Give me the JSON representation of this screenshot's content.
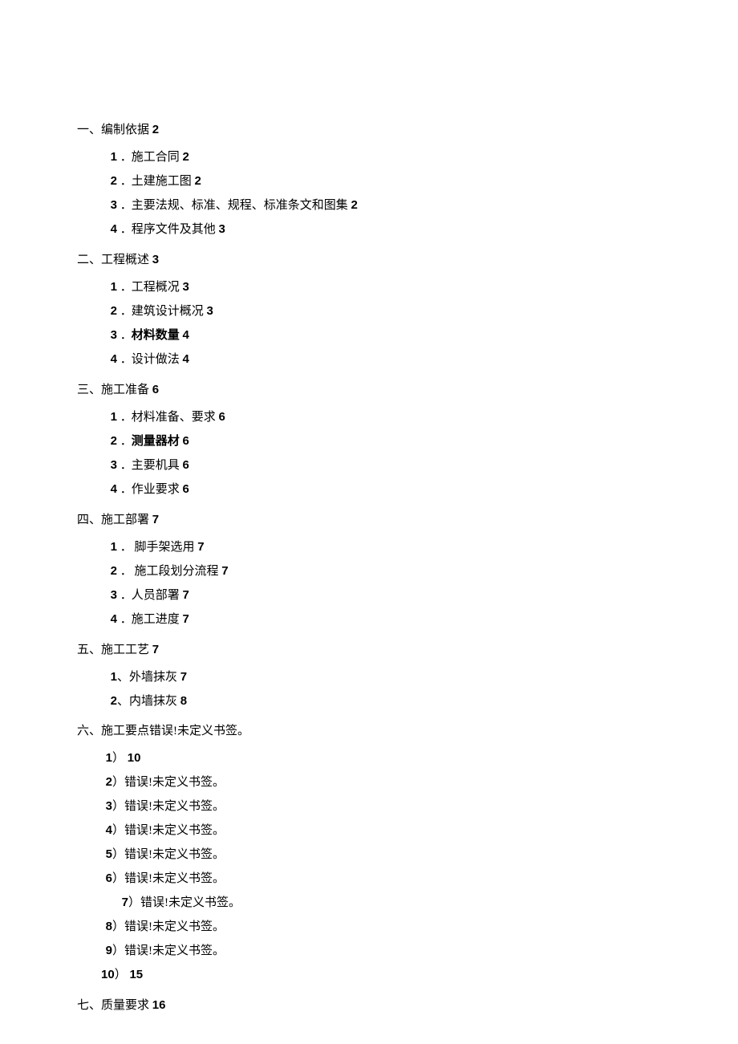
{
  "sections": {
    "s1": {
      "heading_prefix": "一、",
      "heading_title": "编制依据",
      "heading_page": "2",
      "items": [
        {
          "num": "1",
          "sep": "．",
          "title": "施工合同",
          "page": "2",
          "bold_title": false
        },
        {
          "num": "2",
          "sep": "．",
          "title": "土建施工图",
          "page": "2",
          "bold_title": false
        },
        {
          "num": "3",
          "sep": "．",
          "title": "主要法规、标准、规程、标准条文和图集",
          "page": "2",
          "bold_title": false
        },
        {
          "num": "4",
          "sep": "．",
          "title": "程序文件及其他",
          "page": "3",
          "bold_title": false
        }
      ]
    },
    "s2": {
      "heading_prefix": "二、",
      "heading_title": "工程概述",
      "heading_page": "3",
      "items": [
        {
          "num": "1",
          "sep": "．",
          "title": "工程概况",
          "page": "3",
          "bold_title": false
        },
        {
          "num": "2",
          "sep": "．",
          "title": "建筑设计概况",
          "page": "3",
          "bold_title": false
        },
        {
          "num": "3",
          "sep": "．",
          "title": "材料数量",
          "page": "4",
          "bold_title": true
        },
        {
          "num": "4",
          "sep": "．",
          "title": "设计做法",
          "page": "4",
          "bold_title": false
        }
      ]
    },
    "s3": {
      "heading_prefix": "三、",
      "heading_title": "施工准备",
      "heading_page": "6",
      "items": [
        {
          "num": "1",
          "sep": "．",
          "title": "材料准备、要求",
          "page": "6",
          "bold_title": false
        },
        {
          "num": "2",
          "sep": "．",
          "title": "测量器材",
          "page": "6",
          "bold_title": true
        },
        {
          "num": "3",
          "sep": "．",
          "title": "主要机具",
          "page": "6",
          "bold_title": false
        },
        {
          "num": "4",
          "sep": "．",
          "title": "作业要求",
          "page": "6",
          "bold_title": false
        }
      ]
    },
    "s4": {
      "heading_prefix": "四、",
      "heading_title": "施工部署",
      "heading_page": "7",
      "items": [
        {
          "num": "1",
          "sep": "．",
          "title": " 脚手架选用",
          "page": "7",
          "bold_title": false
        },
        {
          "num": "2",
          "sep": "．",
          "title": " 施工段划分流程",
          "page": "7",
          "bold_title": false
        },
        {
          "num": "3",
          "sep": "．",
          "title": "人员部署",
          "page": "7",
          "bold_title": false
        },
        {
          "num": "4",
          "sep": "．",
          "title": "施工进度",
          "page": "7",
          "bold_title": false
        }
      ]
    },
    "s5": {
      "heading_prefix": "五、",
      "heading_title": "施工工艺",
      "heading_page": "7",
      "items": [
        {
          "num": "1",
          "sep": "、",
          "title": "外墙抹灰",
          "page": "7",
          "bold_title": false
        },
        {
          "num": "2",
          "sep": "、",
          "title": "内墙抹灰",
          "page": "8",
          "bold_title": false
        }
      ]
    },
    "s6": {
      "heading_prefix": "六、",
      "heading_title": "施工要点",
      "heading_page": "错误!未定义书签。",
      "items": [
        {
          "num": "1",
          "sep": "）",
          "title": "",
          "page": "10",
          "bold_title": false,
          "page_bold": true
        },
        {
          "num": "2",
          "sep": "）",
          "title": "错误!未定义书签。",
          "page": "",
          "bold_title": false
        },
        {
          "num": "3",
          "sep": "）",
          "title": "错误!未定义书签。",
          "page": "",
          "bold_title": false
        },
        {
          "num": "4",
          "sep": "）",
          "title": "错误!未定义书签。",
          "page": "",
          "bold_title": false
        },
        {
          "num": "5",
          "sep": "）",
          "title": "错误!未定义书签。",
          "page": "",
          "bold_title": false
        },
        {
          "num": "6",
          "sep": "）",
          "title": "错误!未定义书签。",
          "page": "",
          "bold_title": false
        },
        {
          "num": "7",
          "sep": "）",
          "title": "错误!未定义书签。",
          "page": "",
          "bold_title": false,
          "extra_indent": true
        },
        {
          "num": "8",
          "sep": "）",
          "title": "错误!未定义书签。",
          "page": "",
          "bold_title": false
        },
        {
          "num": "9",
          "sep": "）",
          "title": "错误!未定义书签。",
          "page": "",
          "bold_title": false
        },
        {
          "num": "10",
          "sep": "）",
          "title": "",
          "page": "15",
          "bold_title": false,
          "page_bold": true
        }
      ]
    },
    "s7": {
      "heading_prefix": "七、",
      "heading_title": "质量要求",
      "heading_page": "16",
      "items": []
    }
  }
}
